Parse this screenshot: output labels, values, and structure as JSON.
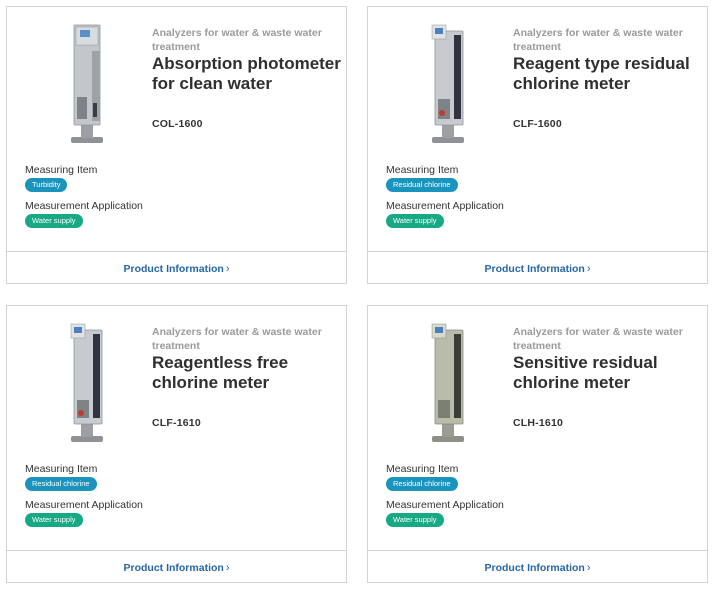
{
  "cards": [
    {
      "category": "Analyzers for water & waste water treatment",
      "title": "Absorption photometer for clean water",
      "model": "COL-1600",
      "measuring_item_label": "Measuring Item",
      "measuring_item_value": "Turbidity",
      "application_label": "Measurement Application",
      "application_value": "Water supply",
      "link_label": "Product Information",
      "link_icon": "chevron-right-icon"
    },
    {
      "category": "Analyzers for water & waste water treatment",
      "title": "Reagent type residual chlorine meter",
      "model": "CLF-1600",
      "measuring_item_label": "Measuring Item",
      "measuring_item_value": "Residual chlorine",
      "application_label": "Measurement Application",
      "application_value": "Water supply",
      "link_label": "Product Information",
      "link_icon": "chevron-right-icon"
    },
    {
      "category": "Analyzers for water & waste water treatment",
      "title": "Reagentless free chlorine meter",
      "model": "CLF-1610",
      "measuring_item_label": "Measuring Item",
      "measuring_item_value": "Residual chlorine",
      "application_label": "Measurement Application",
      "application_value": "Water supply",
      "link_label": "Product Information",
      "link_icon": "chevron-right-icon"
    },
    {
      "category": "Analyzers for water & waste water treatment",
      "title": "Sensitive residual chlorine meter",
      "model": "CLH-1610",
      "measuring_item_label": "Measuring Item",
      "measuring_item_value": "Residual chlorine",
      "application_label": "Measurement Application",
      "application_value": "Water supply",
      "link_label": "Product Information",
      "link_icon": "chevron-right-icon"
    }
  ],
  "colors": {
    "measuring_badge": "#1a94bd",
    "application_badge": "#17a884",
    "link": "#2566a6",
    "border": "#d3d3d3"
  }
}
